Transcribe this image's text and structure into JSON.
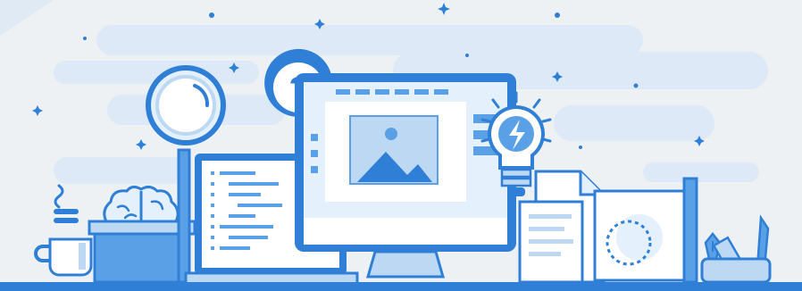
{
  "illustration": {
    "question_glyph": "?",
    "colors": {
      "background": "#eef1f4",
      "cloud": "#dde9f6",
      "primary": "#2f7fd6",
      "mid": "#5aa0e6",
      "light": "#bcd8f3",
      "pale": "#e4f0fb",
      "white": "#ffffff",
      "ground": "#2f7fd6"
    },
    "icons": [
      "coffee-mug-icon",
      "brain-icon",
      "box-icon",
      "magnifying-glass-icon",
      "laptop-icon",
      "question-bubble-icon",
      "monitor-icon",
      "image-icon",
      "lightbulb-icon",
      "document-icon",
      "easel-icon",
      "pen-nib-icon",
      "ruler-icon",
      "utility-knife-icon"
    ]
  }
}
